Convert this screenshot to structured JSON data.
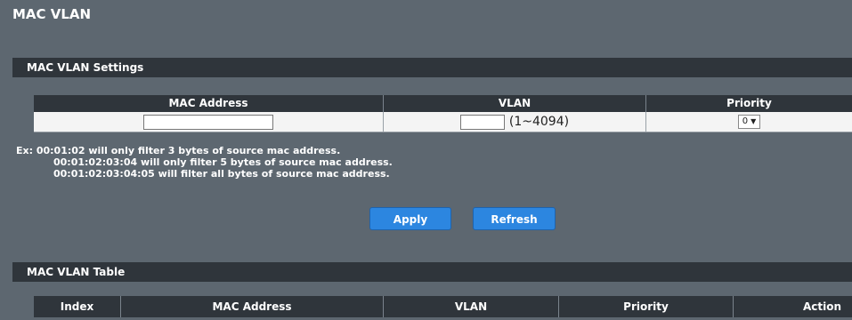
{
  "page_title": "MAC VLAN",
  "settings": {
    "section_title": "MAC VLAN Settings",
    "columns": [
      "MAC Address",
      "VLAN",
      "Priority"
    ],
    "mac_value": "",
    "vlan_value": "",
    "vlan_range": "(1~4094)",
    "priority_value": "0",
    "priority_arrow": "▼"
  },
  "note": {
    "lines": [
      "Ex: 00:01:02 will only filter 3 bytes of source mac address.",
      "00:01:02:03:04 will only filter 5 bytes of source mac address.",
      "00:01:02:03:04:05 will filter all bytes of source mac address."
    ]
  },
  "buttons": {
    "apply": "Apply",
    "refresh": "Refresh"
  },
  "table": {
    "section_title": "MAC VLAN Table",
    "columns": [
      "Index",
      "MAC Address",
      "VLAN",
      "Priority",
      "Action"
    ]
  },
  "colors": {
    "background": "#5d6770",
    "header_bar": "#2f353b",
    "button": "#2c86e0"
  }
}
